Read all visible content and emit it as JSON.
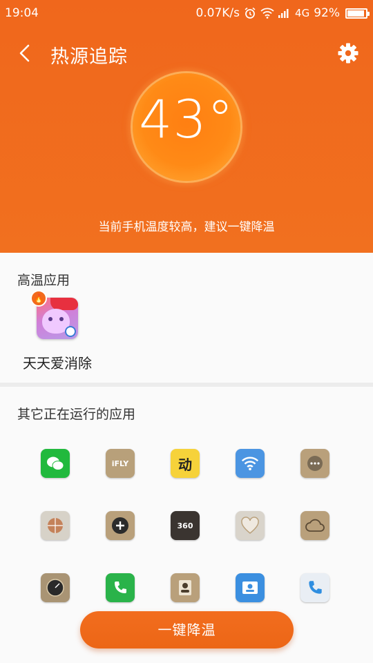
{
  "status_bar": {
    "time": "19:04",
    "net_speed": "0.07K/s",
    "network": "4G",
    "battery": "92%",
    "battery_level": 0.92
  },
  "title_bar": {
    "title": "热源追踪"
  },
  "temperature": {
    "value": "43°",
    "hint": "当前手机温度较高，建议一键降温"
  },
  "hot_apps": {
    "title": "高温应用",
    "items": [
      {
        "name": "天天爱消除",
        "icon": "game-cat-icon"
      }
    ]
  },
  "other_apps": {
    "title": "其它正在运行的应用",
    "items": [
      {
        "icon": "wechat-icon",
        "color": "#21b93d"
      },
      {
        "icon": "ifly-icon",
        "color": "#b8a07a",
        "label": "iFLY"
      },
      {
        "icon": "dong-icon",
        "color": "#f6d23a",
        "label": "动"
      },
      {
        "icon": "wifi-icon",
        "color": "#4b95e2"
      },
      {
        "icon": "chat-bubble-icon",
        "color": "#b9a07b"
      },
      {
        "icon": "basketball-icon",
        "color": "#d7d2c8"
      },
      {
        "icon": "plus-circle-icon",
        "color": "#b9a07b"
      },
      {
        "icon": "home-360-icon",
        "color": "#3a3430",
        "label": "360"
      },
      {
        "icon": "health-heart-icon",
        "color": "#d9d4cb"
      },
      {
        "icon": "cloud-icon",
        "color": "#b9a07b"
      },
      {
        "icon": "clock-icon",
        "color": "#a99474"
      },
      {
        "icon": "phone-green-icon",
        "color": "#2ab34a"
      },
      {
        "icon": "contact-card-icon",
        "color": "#b9a07b"
      },
      {
        "icon": "contacts-blue-icon",
        "color": "#3b8fe0"
      },
      {
        "icon": "phone-blue-icon",
        "color": "#e9eef4"
      }
    ]
  },
  "cta": {
    "label": "一键降温"
  },
  "colors": {
    "accent": "#f0671c",
    "background": "#fafafa"
  }
}
